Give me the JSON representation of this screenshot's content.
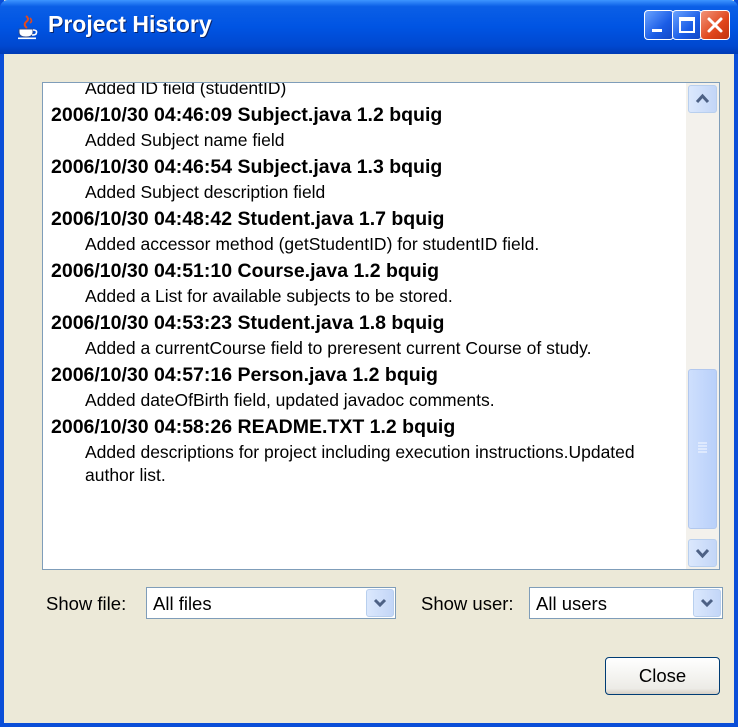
{
  "window": {
    "title": "Project History"
  },
  "titlebar": {
    "buttons": [
      "minimize-icon",
      "maximize-icon",
      "close-icon"
    ]
  },
  "history": [
    {
      "header": "",
      "message": "Added ID field (studentID)"
    },
    {
      "header": "2006/10/30 04:46:09 Subject.java 1.2 bquig",
      "message": "Added Subject name field"
    },
    {
      "header": "2006/10/30 04:46:54 Subject.java 1.3 bquig",
      "message": "Added Subject description field"
    },
    {
      "header": "2006/10/30 04:48:42 Student.java 1.7 bquig",
      "message": "Added accessor method (getStudentID) for studentID field."
    },
    {
      "header": "2006/10/30 04:51:10 Course.java 1.2 bquig",
      "message": "Added a List for available subjects to be stored."
    },
    {
      "header": "2006/10/30 04:53:23 Student.java 1.8 bquig",
      "message": "Added a currentCourse field to preresent current Course of study."
    },
    {
      "header": "2006/10/30 04:57:16 Person.java 1.2 bquig",
      "message": "Added dateOfBirth field, updated javadoc comments."
    },
    {
      "header": "2006/10/30 04:58:26 README.TXT 1.2 bquig",
      "message": "Added descriptions for project including execution instructions.Updated author list."
    }
  ],
  "filters": {
    "file_label": "Show file:",
    "file_value": "All files",
    "user_label": "Show user:",
    "user_value": "All users"
  },
  "actions": {
    "close_label": "Close"
  },
  "colors": {
    "titlebar": "#0054e3",
    "frame": "#0a4ed8",
    "dialog_bg": "#ece9d8",
    "close_red": "#e0461c"
  }
}
